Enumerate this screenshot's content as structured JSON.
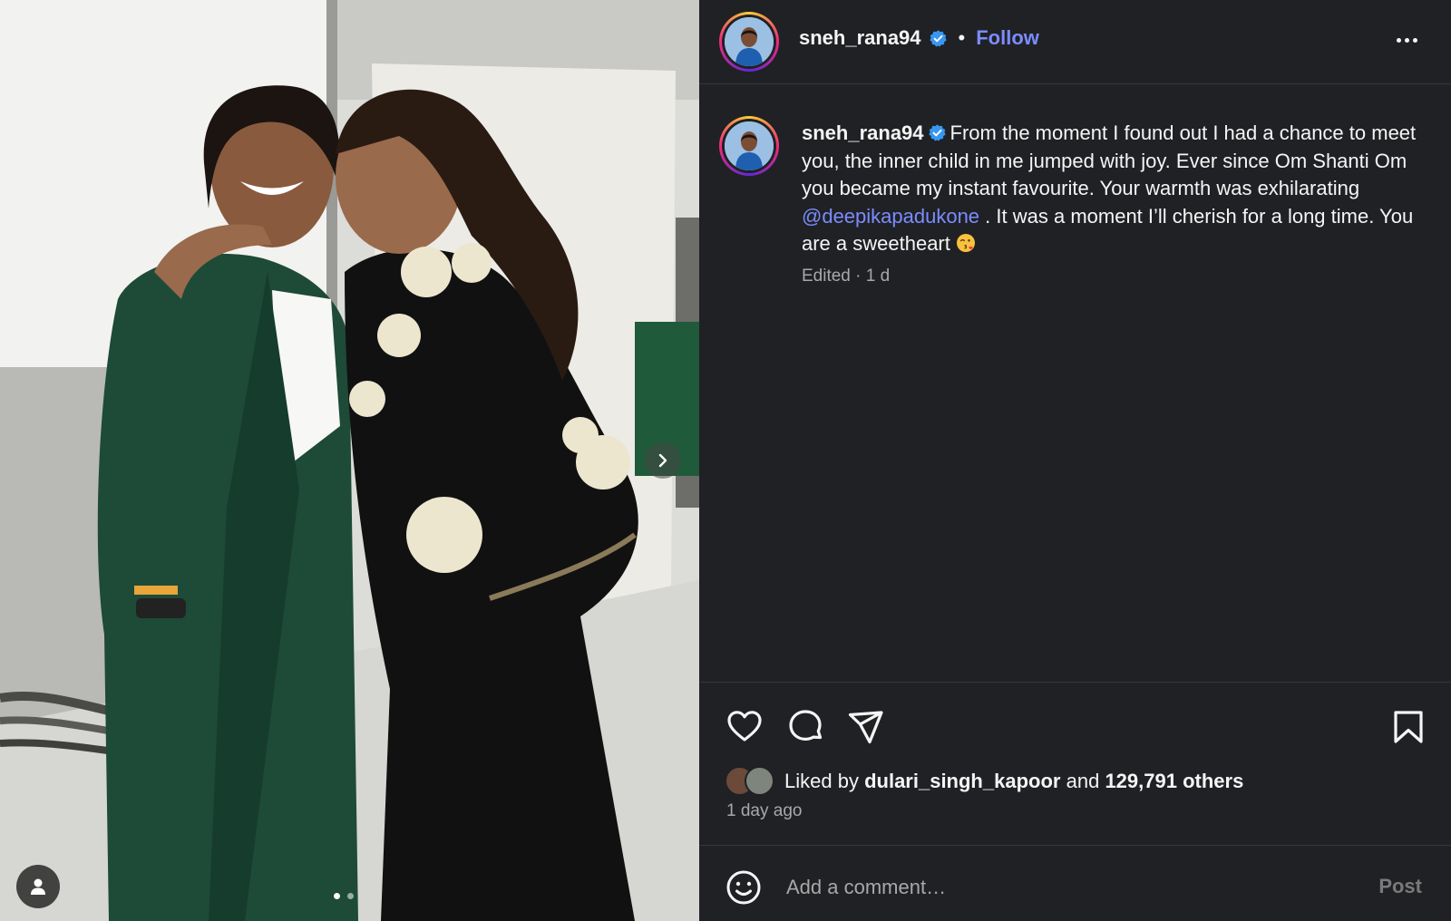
{
  "post": {
    "author": {
      "username": "sneh_rana94",
      "verified": true
    },
    "header": {
      "separator": "•",
      "follow_label": "Follow",
      "more_icon": "more-horizontal-icon"
    },
    "media": {
      "description_icon": "photo-carousel",
      "next_icon": "chevron-right-icon",
      "tag_icon": "user-tag-icon",
      "slide_count": 2,
      "active_slide": 1
    },
    "caption": {
      "text_before_mention": "From the moment I found out I had a chance to meet you, the inner child in me jumped with joy. Ever since Om Shanti Om you became my instant favourite. Your warmth was exhilarating",
      "mention": "@deepikapadukone",
      "text_after_mention": ". It was a moment I’ll cherish for a long time. You are a sweetheart",
      "emoji": "face-blowing-kiss-emoji",
      "meta": "Edited · 1 d"
    },
    "actions": {
      "like_icon": "heart-icon",
      "comment_icon": "comment-icon",
      "share_icon": "send-icon",
      "save_icon": "bookmark-icon"
    },
    "likes": {
      "prefix": "Liked by",
      "liker": "dulari_singh_kapoor",
      "conjunction": "and",
      "others": "129,791 others"
    },
    "timestamp": "1 day ago",
    "comment": {
      "emoji_icon": "smiley-icon",
      "placeholder": "Add a comment…",
      "post_label": "Post"
    }
  },
  "colors": {
    "panel_bg": "#202124",
    "link_blue": "#7b8cff",
    "muted_text": "#a8a8a8",
    "verified_blue": "#3897f0"
  }
}
